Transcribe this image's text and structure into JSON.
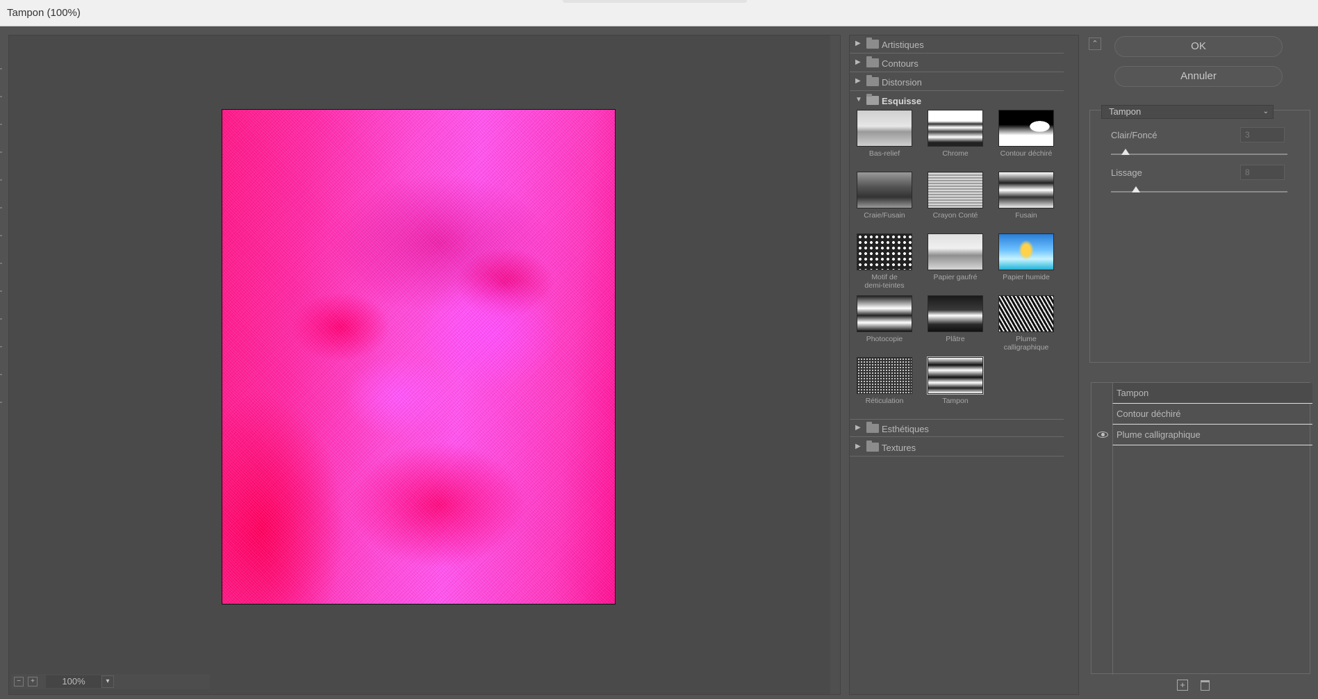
{
  "window": {
    "title": "Tampon (100%)"
  },
  "preview": {
    "zoom": "100%"
  },
  "categories": {
    "artistiques": "Artistiques",
    "contours": "Contours",
    "distorsion": "Distorsion",
    "esquisse": "Esquisse",
    "esthetiques": "Esthétiques",
    "textures": "Textures"
  },
  "esquisse_filters": [
    {
      "label": "Bas-relief",
      "icon": "bas-relief-thumbnail"
    },
    {
      "label": "Chrome",
      "icon": "chrome-thumbnail"
    },
    {
      "label": "Contour déchiré",
      "icon": "contour-dechire-thumbnail"
    },
    {
      "label": "Craie/Fusain",
      "icon": "craie-fusain-thumbnail"
    },
    {
      "label": "Crayon Conté",
      "icon": "crayon-conte-thumbnail"
    },
    {
      "label": "Fusain",
      "icon": "fusain-thumbnail"
    },
    {
      "label": "Motif de\ndemi-teintes",
      "icon": "motif-demi-teintes-thumbnail"
    },
    {
      "label": "Papier gaufré",
      "icon": "papier-gaufre-thumbnail"
    },
    {
      "label": "Papier humide",
      "icon": "papier-humide-thumbnail"
    },
    {
      "label": "Photocopie",
      "icon": "photocopie-thumbnail"
    },
    {
      "label": "Plâtre",
      "icon": "platre-thumbnail"
    },
    {
      "label": "Plume calligraphique",
      "icon": "plume-calligraphique-thumbnail"
    },
    {
      "label": "Réticulation",
      "icon": "reticulation-thumbnail"
    },
    {
      "label": "Tampon",
      "icon": "tampon-thumbnail"
    }
  ],
  "buttons": {
    "ok": "OK",
    "cancel": "Annuler"
  },
  "settings": {
    "filter_select": "Tampon",
    "params": [
      {
        "label": "Clair/Foncé",
        "value": "3",
        "level": 0.0833
      },
      {
        "label": "Lissage",
        "value": "8",
        "level": 0.1428
      }
    ]
  },
  "layers": [
    {
      "name": "Tampon",
      "visible": false
    },
    {
      "name": "Contour déchiré",
      "visible": false
    },
    {
      "name": "Plume calligraphique",
      "visible": true
    }
  ],
  "colors": {
    "accent_image": "#ff3ab8",
    "panel_bg": "#535353"
  }
}
